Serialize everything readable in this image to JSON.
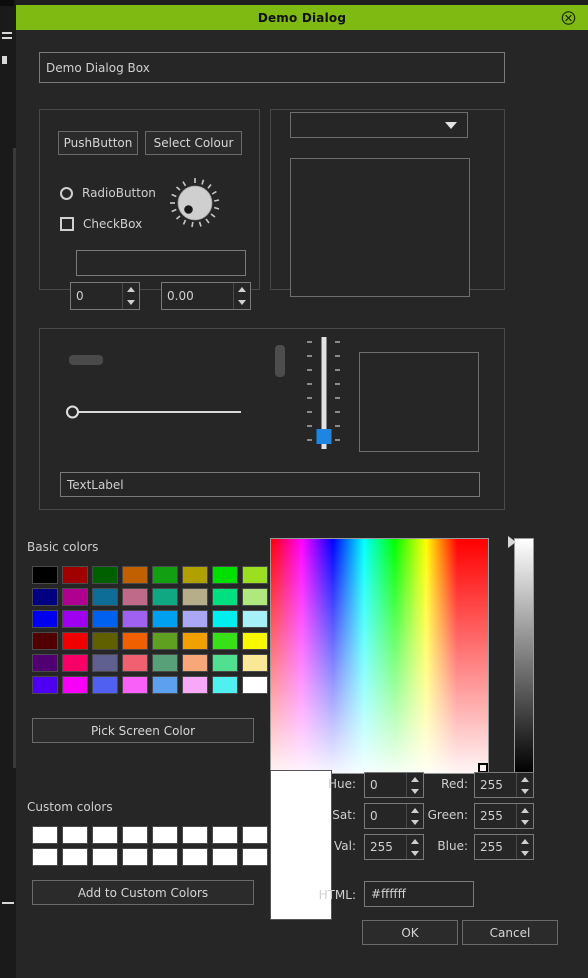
{
  "window": {
    "title": "Demo Dialog",
    "close_icon": "close-circle-icon",
    "titlebar_color": "#7fba12",
    "background_color": "#262626"
  },
  "top_line_edit": {
    "value": "Demo Dialog Box",
    "placeholder": ""
  },
  "widgets_group": {
    "push_button_label": "PushButton",
    "select_colour_label": "Select Colour",
    "radio_label": "RadioButton",
    "check_label": "CheckBox",
    "dial_icon": "dial-knob-icon",
    "text_field_value": "",
    "text_field_placeholder": "",
    "spin_int_value": "0",
    "spin_double_value": "0.00"
  },
  "right_group": {
    "combo_value": "",
    "combo_arrow_icon": "chevron-down-icon",
    "list_value": ""
  },
  "sliders_group": {
    "progress_value": "",
    "scrollbar_icon": "scrollbar-handle-icon",
    "h_slider_value": "",
    "v_slider_value": "",
    "v_slider_handle_color": "#1e86e0",
    "preview_value": "",
    "text_label_value": "TextLabel"
  },
  "color_dialog": {
    "basic_colors_label": "Basic colors",
    "custom_colors_label": "Custom colors",
    "pick_screen_color_label": "Pick Screen Color",
    "add_to_custom_colors_label": "Add to Custom Colors",
    "basic_colors": [
      [
        "#000000",
        "#a00000",
        "#006000",
        "#c06000",
        "#12a012",
        "#b0a000",
        "#00e000",
        "#9ae020"
      ],
      [
        "#000080",
        "#b00090",
        "#0d6d96",
        "#c06a8a",
        "#0fa882",
        "#b6ae8a",
        "#00e080",
        "#b0e880"
      ],
      [
        "#0000f0",
        "#a000f0",
        "#0060f0",
        "#a060f0",
        "#00a0f0",
        "#aaa8f5",
        "#00f0f0",
        "#a8f0f8"
      ],
      [
        "#500000",
        "#f00000",
        "#606000",
        "#f06000",
        "#60a020",
        "#f0a000",
        "#38e018",
        "#f8f800"
      ],
      [
        "#500070",
        "#f80068",
        "#606090",
        "#f06070",
        "#58a078",
        "#f8a878",
        "#50e090",
        "#f8e898"
      ],
      [
        "#5000f0",
        "#f800f8",
        "#5060f0",
        "#f860f8",
        "#5ea0f0",
        "#f8a8f8",
        "#50f0f0",
        "#ffffff"
      ]
    ],
    "custom_colors_rows": 2,
    "custom_colors_cols": 8,
    "custom_color_fill": "#ffffff",
    "sv_cursor_icon": "color-crosshair-icon",
    "value_slider_arrow_icon": "value-slider-arrow-icon",
    "preview_color": "#ffffff",
    "fields": {
      "hue_label": "Hue:",
      "hue_value": "0",
      "sat_label": "Sat:",
      "sat_value": "0",
      "val_label": "Val:",
      "val_value": "255",
      "red_label": "Red:",
      "red_value": "255",
      "green_label": "Green:",
      "green_value": "255",
      "blue_label": "Blue:",
      "blue_value": "255",
      "html_label": "HTML:",
      "html_value": "#ffffff"
    }
  },
  "buttons": {
    "ok_label": "OK",
    "cancel_label": "Cancel"
  }
}
